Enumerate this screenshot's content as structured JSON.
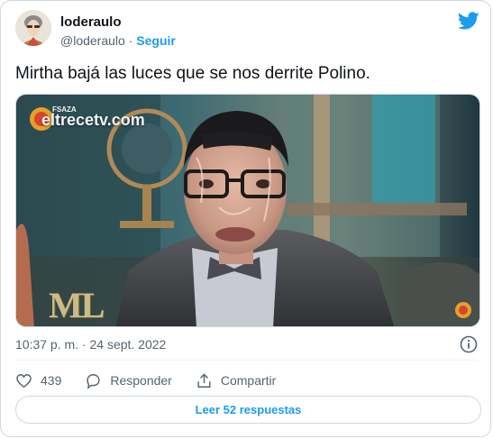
{
  "author": {
    "name": "loderaulo",
    "handle": "@loderaulo",
    "separator": "·",
    "follow_label": "Seguir"
  },
  "brand_icon": "twitter-bird-icon",
  "tweet": {
    "text": "Mirtha bajá las luces que se nos derrite Polino."
  },
  "media": {
    "watermark": "eltrecetv.com",
    "watermark_sub": "FSAZA",
    "show_logo": "ML"
  },
  "meta": {
    "timestamp": "10:37 p. m. · 24 sept. 2022"
  },
  "actions": {
    "like_count": "439",
    "reply_label": "Responder",
    "share_label": "Compartir"
  },
  "read_replies_label": "Leer 52 respuestas",
  "colors": {
    "accent": "#1d9bf0",
    "text": "#0f1419",
    "secondary": "#536471",
    "border": "#cfd9de"
  }
}
